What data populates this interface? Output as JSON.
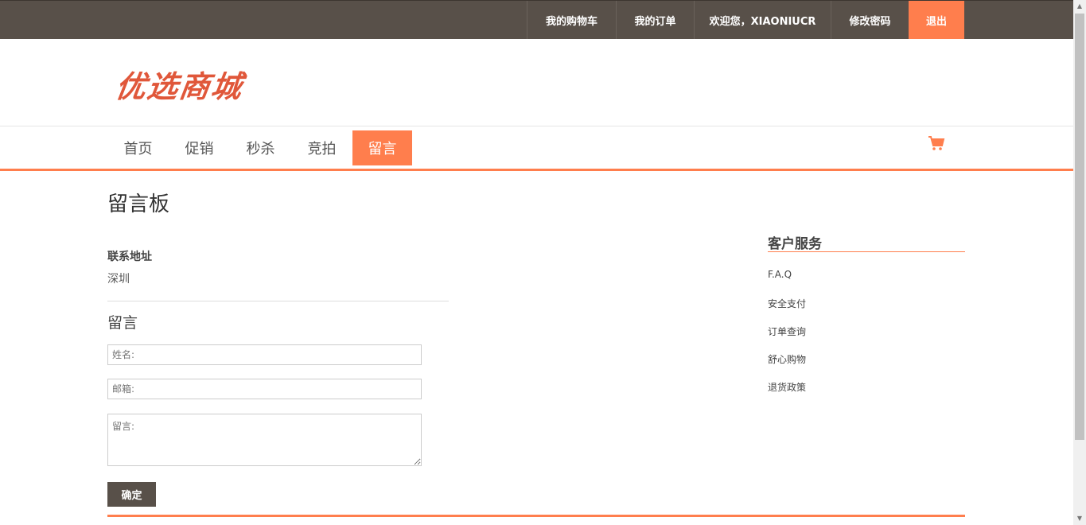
{
  "topbar": {
    "cart": "我的购物车",
    "orders": "我的订单",
    "welcome": "欢迎您，XIAONIUCR",
    "change_password": "修改密码",
    "logout": "退出"
  },
  "logo_text": "优选商城",
  "nav": [
    {
      "label": "首页"
    },
    {
      "label": "促销"
    },
    {
      "label": "秒杀"
    },
    {
      "label": "竞拍"
    },
    {
      "label": "留言"
    }
  ],
  "page_title": "留言板",
  "contact": {
    "label": "联系地址",
    "value": "深圳"
  },
  "message_form": {
    "title": "留言",
    "name_placeholder": "姓名:",
    "email_placeholder": "邮箱:",
    "message_placeholder": "留言:",
    "submit_label": "确定"
  },
  "sidebar": {
    "title": "客户服务",
    "items": [
      "F.A.Q",
      "安全支付",
      "订单查询",
      "舒心购物",
      "退货政策"
    ]
  },
  "colors": {
    "accent": "#ff7e4d",
    "topbar": "#585049"
  }
}
